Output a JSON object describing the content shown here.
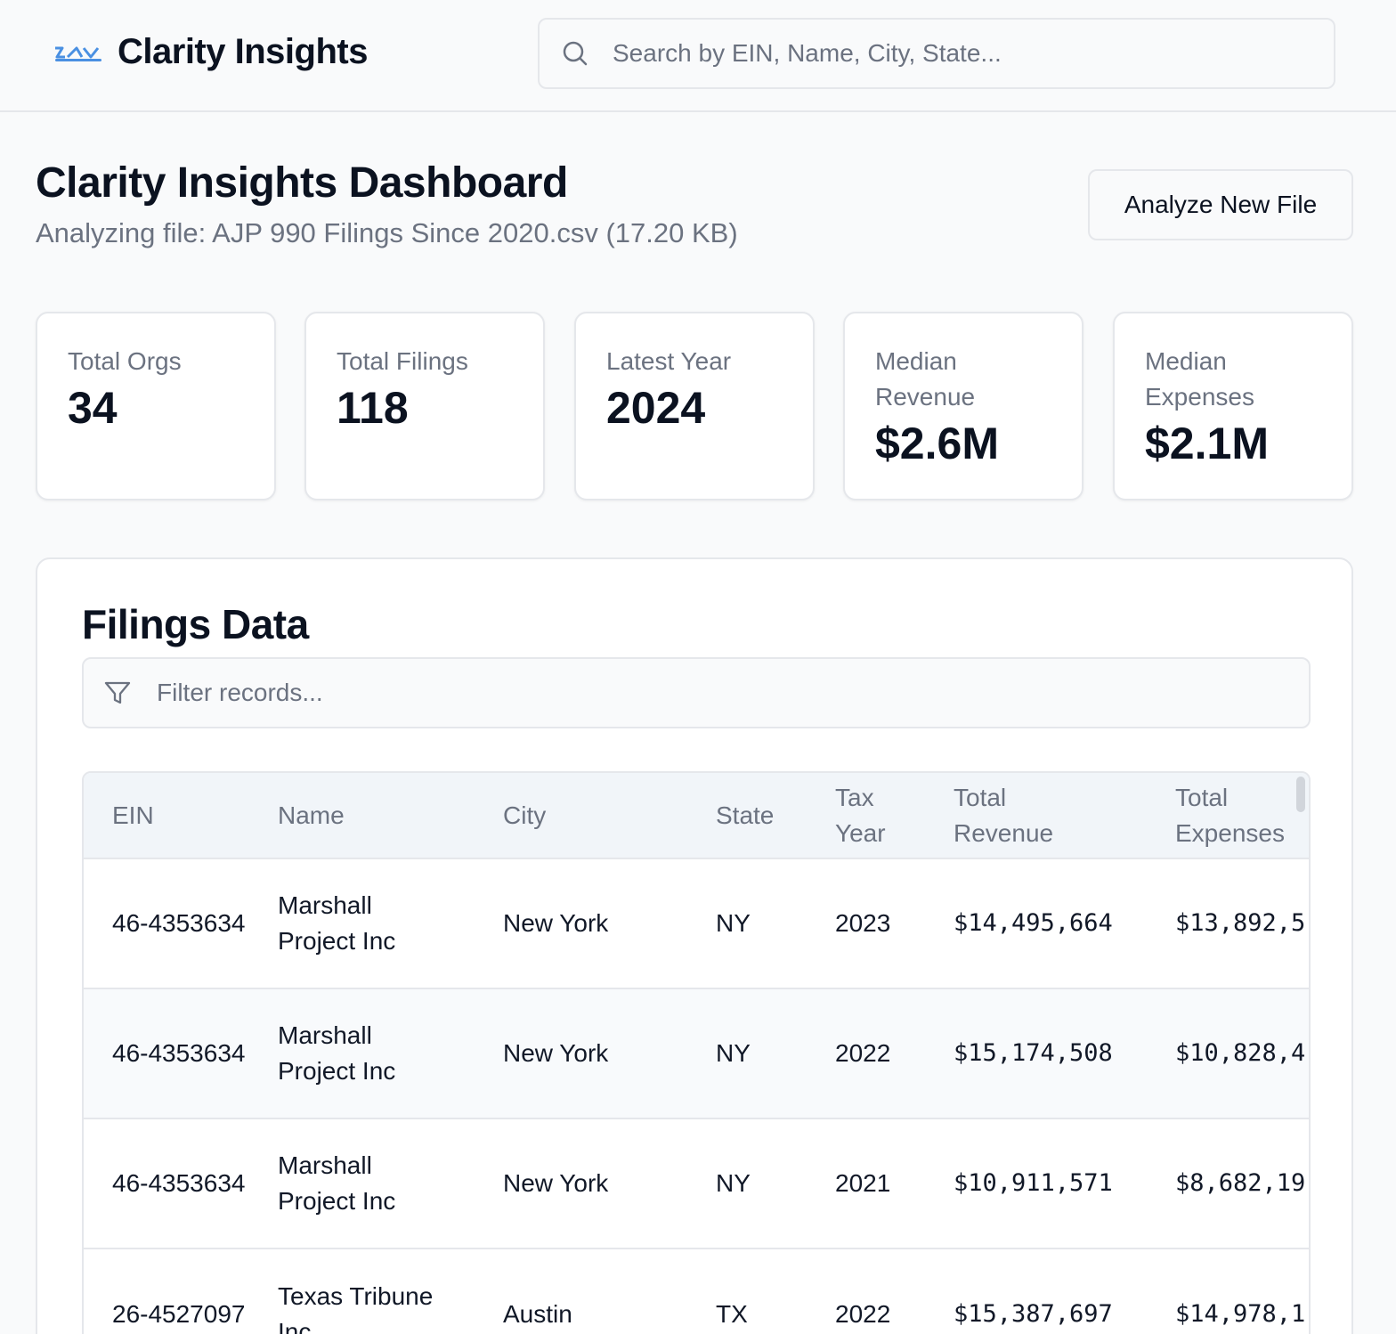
{
  "header": {
    "brand": "Clarity Insights",
    "search_placeholder": "Search by EIN, Name, City, State..."
  },
  "page": {
    "title": "Clarity Insights Dashboard",
    "subtitle": "Analyzing file: AJP 990 Filings Since 2020.csv (17.20 KB)",
    "analyze_button": "Analyze New File"
  },
  "stats": [
    {
      "label": "Total Orgs",
      "value": "34"
    },
    {
      "label": "Total Filings",
      "value": "118"
    },
    {
      "label": "Latest Year",
      "value": "2024"
    },
    {
      "label": "Median Revenue",
      "value": "$2.6M"
    },
    {
      "label": "Median Expenses",
      "value": "$2.1M"
    }
  ],
  "filings": {
    "title": "Filings Data",
    "filter_placeholder": "Filter records...",
    "columns": [
      "EIN",
      "Name",
      "City",
      "State",
      "Tax Year",
      "Total Revenue",
      "Total Expenses"
    ],
    "rows": [
      {
        "ein": "46-4353634",
        "name": "Marshall Project Inc",
        "city": "New York",
        "state": "NY",
        "year": "2023",
        "revenue": "$14,495,664",
        "expenses": "$13,892,5"
      },
      {
        "ein": "46-4353634",
        "name": "Marshall Project Inc",
        "city": "New York",
        "state": "NY",
        "year": "2022",
        "revenue": "$15,174,508",
        "expenses": "$10,828,4"
      },
      {
        "ein": "46-4353634",
        "name": "Marshall Project Inc",
        "city": "New York",
        "state": "NY",
        "year": "2021",
        "revenue": "$10,911,571",
        "expenses": "$8,682,19"
      },
      {
        "ein": "26-4527097",
        "name": "Texas Tribune Inc",
        "city": "Austin",
        "state": "TX",
        "year": "2022",
        "revenue": "$15,387,697",
        "expenses": "$14,978,1"
      }
    ]
  },
  "colors": {
    "accent": "#4a90e2",
    "text": "#0b1220",
    "muted": "#6b7280",
    "border": "#e5e7eb",
    "header_bg": "#f1f5f9"
  },
  "icons": [
    "logo-icon",
    "search-icon",
    "filter-icon"
  ]
}
